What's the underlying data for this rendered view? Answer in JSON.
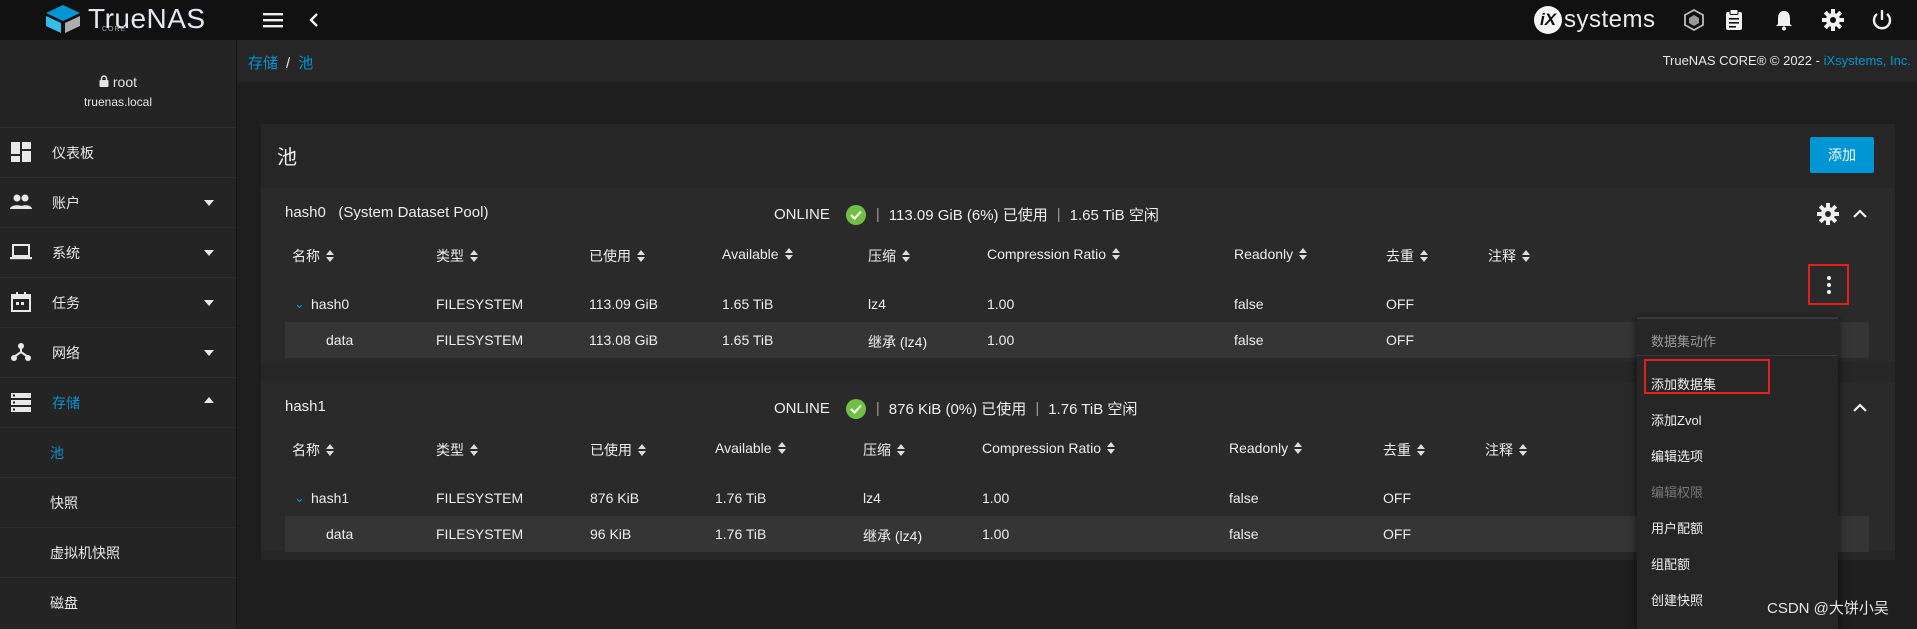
{
  "topbar": {
    "logo_text": "TrueNAS",
    "logo_sub": "CORE",
    "brand": "systems",
    "brand_mark": "iX"
  },
  "sidebar": {
    "user": "root",
    "host": "truenas.local",
    "items": [
      {
        "label": "仪表板",
        "icon": "dashboard-icon",
        "caret": "none"
      },
      {
        "label": "账户",
        "icon": "people-icon",
        "caret": "down"
      },
      {
        "label": "系统",
        "icon": "laptop-icon",
        "caret": "down"
      },
      {
        "label": "任务",
        "icon": "calendar-icon",
        "caret": "down"
      },
      {
        "label": "网络",
        "icon": "network-icon",
        "caret": "down"
      },
      {
        "label": "存储",
        "icon": "storage-icon",
        "caret": "up",
        "active": true
      }
    ],
    "subitems": [
      {
        "label": "池",
        "active": true
      },
      {
        "label": "快照"
      },
      {
        "label": "虚拟机快照"
      },
      {
        "label": "磁盘"
      }
    ]
  },
  "breadcrumb": {
    "root": "存储",
    "sep": "/",
    "current": "池"
  },
  "copyright": {
    "text": "TrueNAS CORE® © 2022 - ",
    "link": "iXsystems, Inc."
  },
  "card": {
    "title": "池",
    "add_label": "添加"
  },
  "columns": [
    "名称",
    "类型",
    "已使用",
    "Available",
    "压缩",
    "Compression Ratio",
    "Readonly",
    "去重",
    "注释"
  ],
  "pools": [
    {
      "name": "hash0",
      "note": "(System Dataset Pool)",
      "state": "ONLINE",
      "used": "113.09 GiB (6%) 已使用",
      "free": "1.65 TiB 空闲",
      "rows": [
        {
          "name": "hash0",
          "type": "FILESYSTEM",
          "used": "113.09 GiB",
          "avail": "1.65 TiB",
          "comp": "lz4",
          "ratio": "1.00",
          "ro": "false",
          "dedup": "OFF"
        },
        {
          "name": "data",
          "type": "FILESYSTEM",
          "used": "113.08 GiB",
          "avail": "1.65 TiB",
          "comp": "继承 (lz4)",
          "ratio": "1.00",
          "ro": "false",
          "dedup": "OFF"
        }
      ]
    },
    {
      "name": "hash1",
      "note": "",
      "state": "ONLINE",
      "used": "876 KiB (0%) 已使用",
      "free": "1.76 TiB 空闲",
      "rows": [
        {
          "name": "hash1",
          "type": "FILESYSTEM",
          "used": "876 KiB",
          "avail": "1.76 TiB",
          "comp": "lz4",
          "ratio": "1.00",
          "ro": "false",
          "dedup": "OFF"
        },
        {
          "name": "data",
          "type": "FILESYSTEM",
          "used": "96 KiB",
          "avail": "1.76 TiB",
          "comp": "继承 (lz4)",
          "ratio": "1.00",
          "ro": "false",
          "dedup": "OFF"
        }
      ]
    }
  ],
  "menu": {
    "header": "数据集动作",
    "items": [
      {
        "label": "添加数据集",
        "enabled": true
      },
      {
        "label": "添加Zvol",
        "enabled": true
      },
      {
        "label": "编辑选项",
        "enabled": true
      },
      {
        "label": "编辑权限",
        "enabled": false
      },
      {
        "label": "用户配额",
        "enabled": true
      },
      {
        "label": "组配额",
        "enabled": true
      },
      {
        "label": "创建快照",
        "enabled": true
      }
    ]
  },
  "watermark": "CSDN @大饼小吴",
  "colors": {
    "accent": "#0095d5",
    "ok": "#71bf44",
    "highlight": "#e0211d"
  }
}
